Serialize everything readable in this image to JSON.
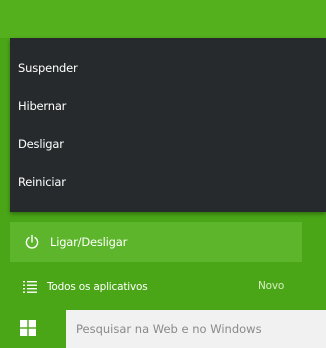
{
  "power_menu": {
    "items": [
      {
        "label": "Suspender"
      },
      {
        "label": "Hibernar"
      },
      {
        "label": "Desligar"
      },
      {
        "label": "Reiniciar"
      }
    ]
  },
  "start_menu": {
    "power_button": {
      "label": "Ligar/Desligar",
      "icon": "power-icon"
    },
    "all_apps": {
      "label": "Todos os aplicativos",
      "badge": "Novo",
      "icon": "list-icon"
    }
  },
  "taskbar": {
    "start_icon": "windows-logo-icon",
    "search": {
      "placeholder": "Pesquisar na Web e no Windows"
    }
  },
  "colors": {
    "accent": "#4aa617",
    "menu_background": "#262a2d",
    "power_button_background": "#5cb52a",
    "search_background": "#f1f1f1"
  }
}
